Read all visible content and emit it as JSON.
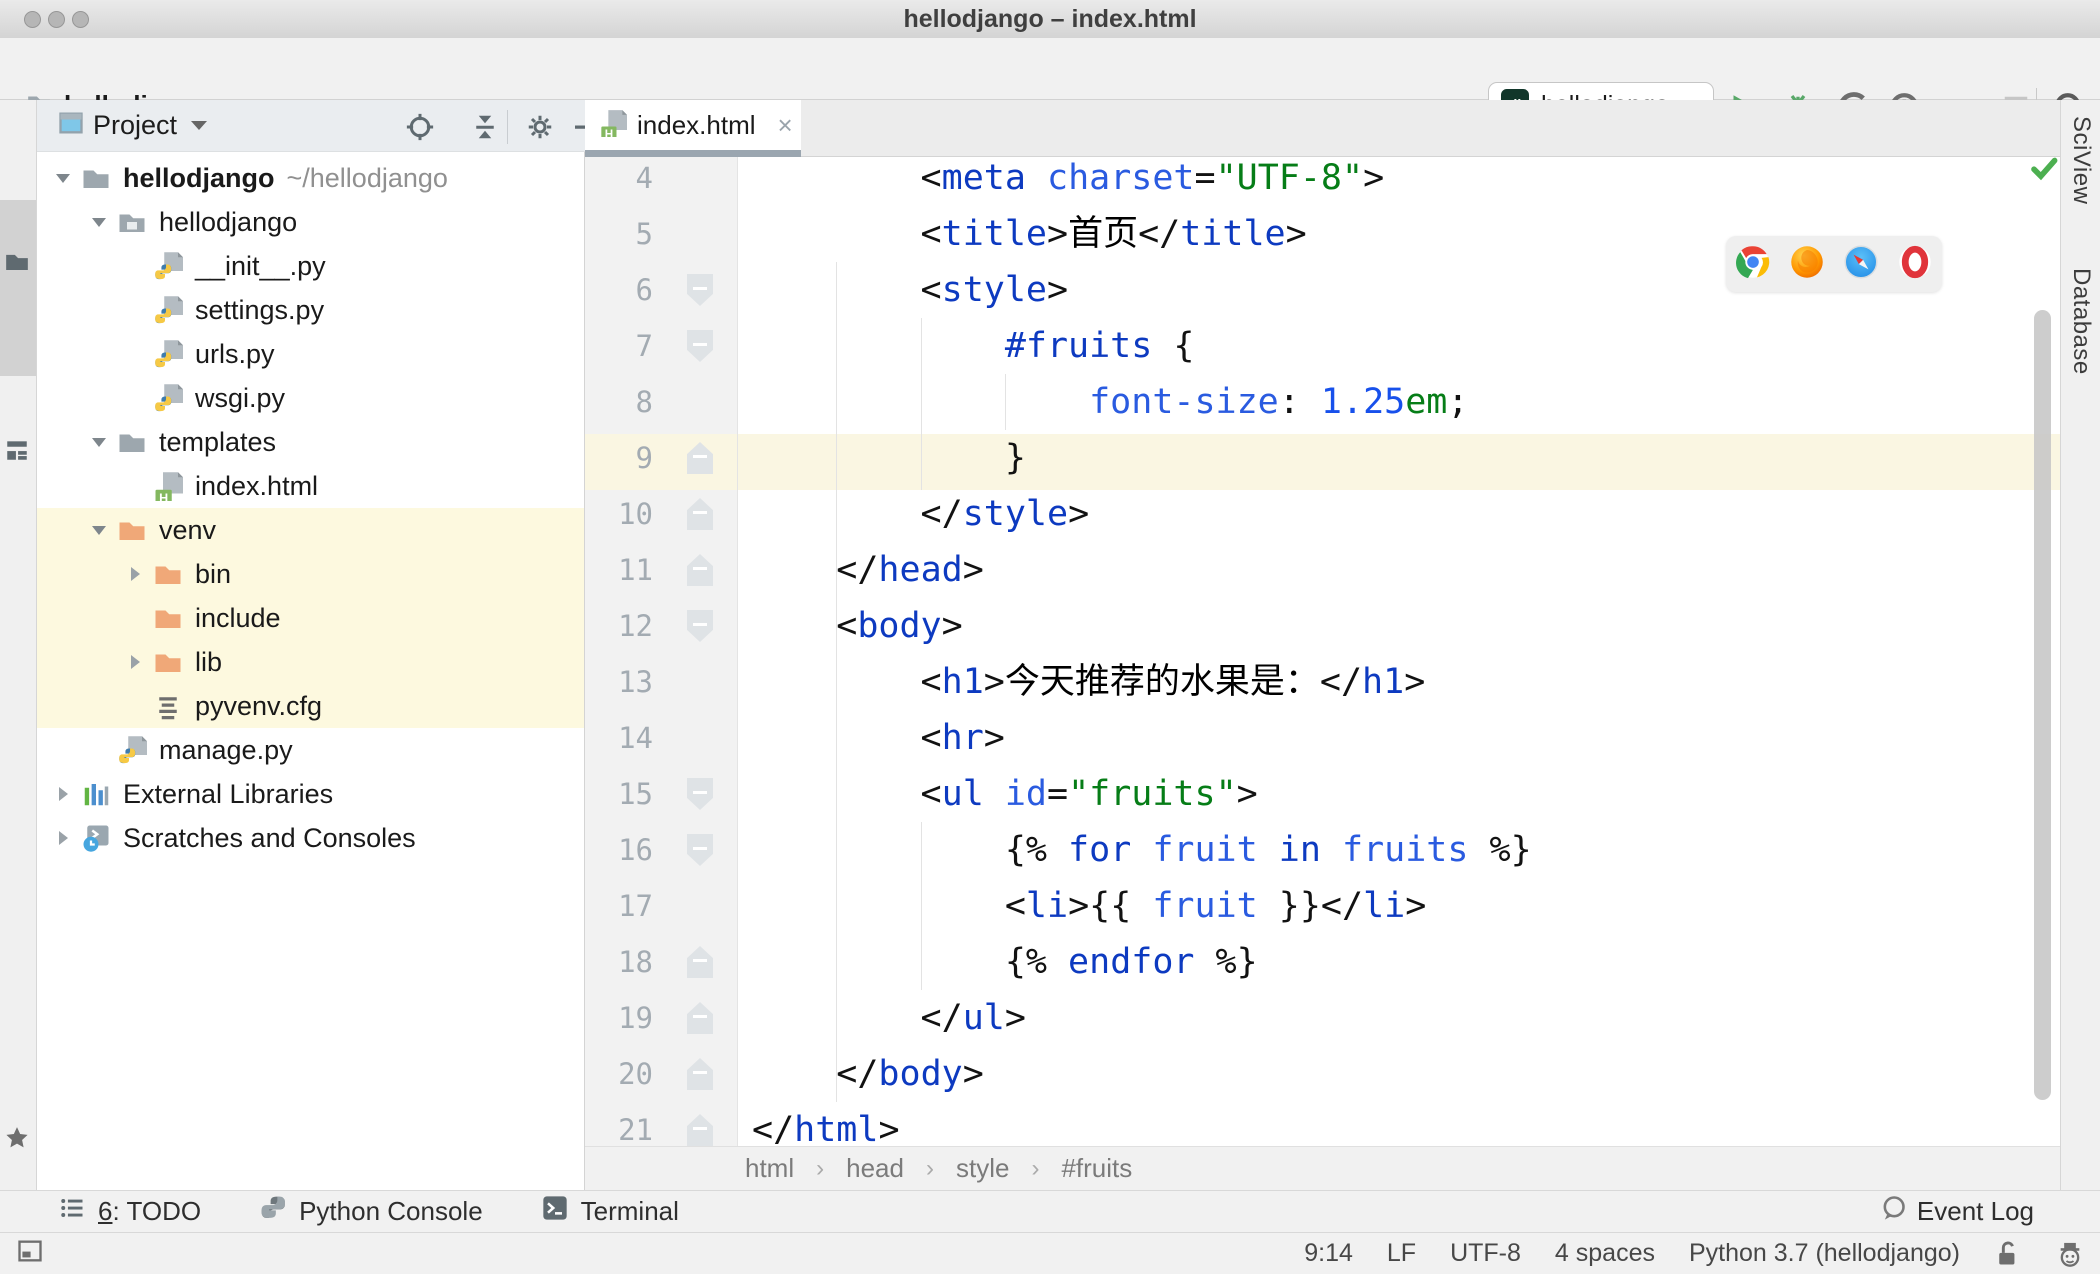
{
  "window": {
    "title": "hellodjango – index.html",
    "traffic_lights": [
      "close",
      "minimize",
      "zoom"
    ]
  },
  "navbar": {
    "root_crumb": "hellodjango",
    "run_config": {
      "label": "hellodjango",
      "icon": "django"
    },
    "toolbar_icons": [
      "run",
      "debug",
      "run-with-coverage",
      "profile",
      "concurrency-diagram",
      "stop",
      "search-everywhere"
    ]
  },
  "stripes": {
    "left": [
      {
        "label": "1: Project",
        "mnemonic": "1",
        "icon": "stripe-project",
        "active": true
      },
      {
        "label": "7: Structure",
        "mnemonic": "7",
        "icon": "stripe-structure",
        "active": false
      }
    ],
    "left_bottom": [
      {
        "label": "2: Favorites",
        "mnemonic": "2",
        "icon": "star",
        "active": false
      }
    ],
    "right": [
      {
        "label": "SciView",
        "icon": "sciview"
      },
      {
        "label": "Database",
        "icon": "database"
      }
    ]
  },
  "project_panel": {
    "header": {
      "title": "Project",
      "icons": [
        "locate",
        "collapse-all",
        "settings",
        "hide"
      ]
    },
    "tree": [
      {
        "label": "hellodjango",
        "suffix": "~/hellodjango",
        "icon": "folder",
        "level": 0,
        "arrow": "open",
        "bold": true
      },
      {
        "label": "hellodjango",
        "icon": "folder-pkg",
        "level": 1,
        "arrow": "open"
      },
      {
        "label": "__init__.py",
        "icon": "py",
        "level": 2
      },
      {
        "label": "settings.py",
        "icon": "py",
        "level": 2
      },
      {
        "label": "urls.py",
        "icon": "py",
        "level": 2
      },
      {
        "label": "wsgi.py",
        "icon": "py",
        "level": 2
      },
      {
        "label": "templates",
        "icon": "folder",
        "level": 1,
        "arrow": "open"
      },
      {
        "label": "index.html",
        "icon": "html",
        "level": 2
      },
      {
        "label": "venv",
        "icon": "folder-ex",
        "level": 1,
        "arrow": "open",
        "hl": true
      },
      {
        "label": "bin",
        "icon": "folder-ex",
        "level": 2,
        "arrow": "closed",
        "hl": true
      },
      {
        "label": "include",
        "icon": "folder-ex",
        "level": 2,
        "hl": true
      },
      {
        "label": "lib",
        "icon": "folder-ex",
        "level": 2,
        "arrow": "closed",
        "hl": true
      },
      {
        "label": "pyvenv.cfg",
        "icon": "textfile",
        "level": 2,
        "hl": true
      },
      {
        "label": "manage.py",
        "icon": "py",
        "level": 1
      },
      {
        "label": "External Libraries",
        "icon": "extlib",
        "level": 0,
        "arrow": "closed"
      },
      {
        "label": "Scratches and Consoles",
        "icon": "scratch",
        "level": 0,
        "arrow": "closed"
      }
    ]
  },
  "editor": {
    "tab": {
      "label": "index.html",
      "icon": "html",
      "close": "×"
    },
    "browser_popup": [
      "chrome",
      "firefox",
      "safari",
      "opera"
    ],
    "caret_line": 9,
    "lines": [
      {
        "n": 4,
        "indent": 8,
        "tokens": [
          [
            "p",
            "<"
          ],
          [
            "tag",
            "meta"
          ],
          [
            "attr",
            " charset"
          ],
          [
            "p",
            "="
          ],
          [
            "str",
            "\"UTF-8\""
          ],
          [
            "p",
            ">"
          ]
        ]
      },
      {
        "n": 5,
        "indent": 8,
        "tokens": [
          [
            "p",
            "<"
          ],
          [
            "tag",
            "title"
          ],
          [
            "p",
            ">"
          ],
          [
            "t",
            "首页"
          ],
          [
            "p",
            "</"
          ],
          [
            "tag",
            "title"
          ],
          [
            "p",
            ">"
          ]
        ]
      },
      {
        "n": 6,
        "indent": 8,
        "fold": "down",
        "tokens": [
          [
            "p",
            "<"
          ],
          [
            "tag",
            "style"
          ],
          [
            "p",
            ">"
          ]
        ]
      },
      {
        "n": 7,
        "indent": 12,
        "fold": "down",
        "tokens": [
          [
            "sel",
            "#fruits"
          ],
          [
            "p",
            " {"
          ]
        ]
      },
      {
        "n": 8,
        "indent": 16,
        "tokens": [
          [
            "prop",
            "font-size"
          ],
          [
            "p",
            ": "
          ],
          [
            "num",
            "1.25"
          ],
          [
            "unit",
            "em"
          ],
          [
            "p",
            ";"
          ]
        ]
      },
      {
        "n": 9,
        "indent": 12,
        "fold": "up",
        "tokens": [
          [
            "p",
            "}"
          ]
        ]
      },
      {
        "n": 10,
        "indent": 8,
        "fold": "up",
        "tokens": [
          [
            "p",
            "</"
          ],
          [
            "tag",
            "style"
          ],
          [
            "p",
            ">"
          ]
        ]
      },
      {
        "n": 11,
        "indent": 4,
        "fold": "up",
        "tokens": [
          [
            "p",
            "</"
          ],
          [
            "tag",
            "head"
          ],
          [
            "p",
            ">"
          ]
        ]
      },
      {
        "n": 12,
        "indent": 4,
        "fold": "down",
        "tokens": [
          [
            "p",
            "<"
          ],
          [
            "tag",
            "body"
          ],
          [
            "p",
            ">"
          ]
        ]
      },
      {
        "n": 13,
        "indent": 8,
        "tokens": [
          [
            "p",
            "<"
          ],
          [
            "tag",
            "h1"
          ],
          [
            "p",
            ">"
          ],
          [
            "t",
            "今天推荐的水果是："
          ],
          [
            "p",
            "</"
          ],
          [
            "tag",
            "h1"
          ],
          [
            "p",
            ">"
          ]
        ]
      },
      {
        "n": 14,
        "indent": 8,
        "tokens": [
          [
            "p",
            "<"
          ],
          [
            "tag",
            "hr"
          ],
          [
            "p",
            ">"
          ]
        ]
      },
      {
        "n": 15,
        "indent": 8,
        "fold": "down",
        "tokens": [
          [
            "p",
            "<"
          ],
          [
            "tag",
            "ul"
          ],
          [
            "attr",
            " id"
          ],
          [
            "p",
            "="
          ],
          [
            "str",
            "\"fruits\""
          ],
          [
            "p",
            ">"
          ]
        ]
      },
      {
        "n": 16,
        "indent": 12,
        "fold": "down",
        "tokens": [
          [
            "p",
            "{% "
          ],
          [
            "kw",
            "for"
          ],
          [
            "var",
            " fruit "
          ],
          [
            "kw",
            "in"
          ],
          [
            "var",
            " fruits"
          ],
          [
            "p",
            " %}"
          ]
        ]
      },
      {
        "n": 17,
        "indent": 12,
        "tokens": [
          [
            "p",
            "<"
          ],
          [
            "tag",
            "li"
          ],
          [
            "p",
            ">{{ "
          ],
          [
            "var",
            "fruit"
          ],
          [
            "p",
            " }}</"
          ],
          [
            "tag",
            "li"
          ],
          [
            "p",
            ">"
          ]
        ]
      },
      {
        "n": 18,
        "indent": 12,
        "fold": "up",
        "tokens": [
          [
            "p",
            "{% "
          ],
          [
            "kw",
            "endfor"
          ],
          [
            "p",
            " %}"
          ]
        ]
      },
      {
        "n": 19,
        "indent": 8,
        "fold": "up",
        "tokens": [
          [
            "p",
            "</"
          ],
          [
            "tag",
            "ul"
          ],
          [
            "p",
            ">"
          ]
        ]
      },
      {
        "n": 20,
        "indent": 4,
        "fold": "up",
        "tokens": [
          [
            "p",
            "</"
          ],
          [
            "tag",
            "body"
          ],
          [
            "p",
            ">"
          ]
        ]
      },
      {
        "n": 21,
        "indent": 0,
        "fold": "up",
        "tokens": [
          [
            "p",
            "</"
          ],
          [
            "tag",
            "html"
          ],
          [
            "p",
            ">"
          ]
        ]
      }
    ],
    "breadcrumbs": [
      "html",
      "head",
      "style",
      "#fruits"
    ]
  },
  "bottom_bar": {
    "buttons": [
      {
        "label": "6: TODO",
        "mnemonic": "6",
        "icon": "todo"
      },
      {
        "label": "Python Console",
        "icon": "python-gray"
      },
      {
        "label": "Terminal",
        "icon": "terminal"
      }
    ],
    "event_log": {
      "label": "Event Log",
      "icon": "balloon"
    }
  },
  "status_bar": {
    "segments": [
      "9:14",
      "LF",
      "UTF-8",
      "4 spaces",
      "Python 3.7 (hellodjango)"
    ],
    "icons": [
      "unlock",
      "hector"
    ]
  },
  "colors": {
    "accent_green": "#59A869",
    "tag_blue": "#0D3AC0",
    "attr_blue": "#2A5BE0",
    "string_green": "#067D17",
    "number_blue": "#1750EB",
    "caret_line": "#FAF6E2",
    "excluded_yellow": "#FDF9DF",
    "tab_underline": "#9BA6B0"
  }
}
